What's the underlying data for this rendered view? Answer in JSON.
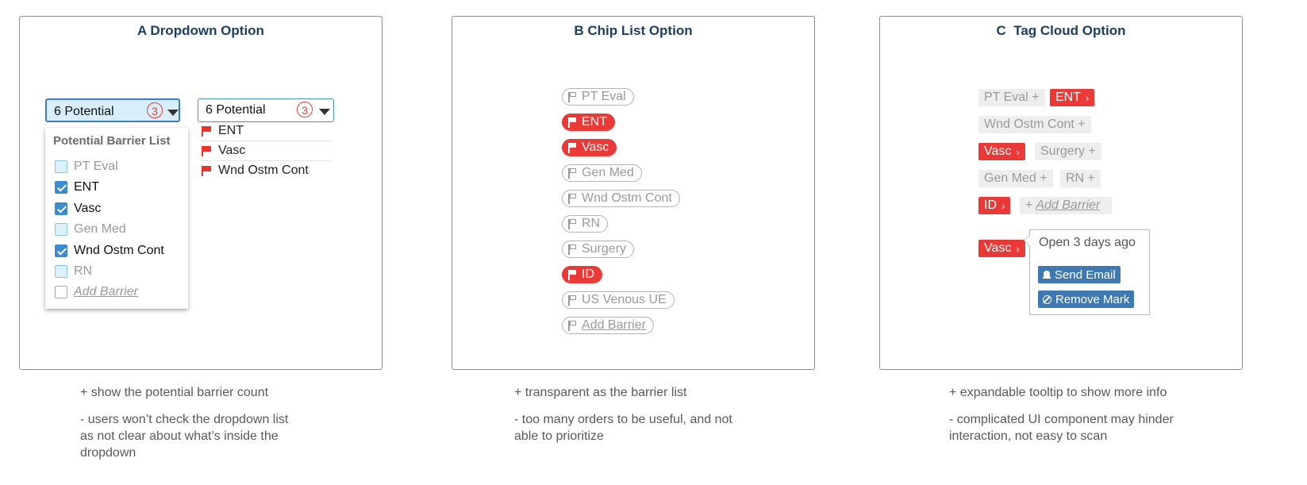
{
  "panels": {
    "a": {
      "title": "A Dropdown Option",
      "dropdown_active": {
        "label": "6 Potential",
        "count": "3"
      },
      "dropdown_flagged": {
        "label": "6 Potential",
        "count": "3"
      },
      "menu": {
        "heading": "Potential Barrier List",
        "items": [
          {
            "label": "PT Eval",
            "state": "unchecked"
          },
          {
            "label": "ENT",
            "state": "checked"
          },
          {
            "label": "Vasc",
            "state": "checked"
          },
          {
            "label": "Gen Med",
            "state": "unchecked"
          },
          {
            "label": "Wnd Ostm Cont",
            "state": "checked"
          },
          {
            "label": "RN",
            "state": "unchecked"
          },
          {
            "label": "Add Barrier",
            "state": "add"
          }
        ]
      },
      "flagged_list": [
        "ENT",
        "Vasc",
        "Wnd Ostm Cont"
      ]
    },
    "b": {
      "title": "B Chip List Option",
      "chips": [
        {
          "label": "PT Eval",
          "flagged": false
        },
        {
          "label": "ENT",
          "flagged": true
        },
        {
          "label": "Vasc",
          "flagged": true
        },
        {
          "label": "Gen Med",
          "flagged": false
        },
        {
          "label": "Wnd Ostm Cont",
          "flagged": false
        },
        {
          "label": "RN",
          "flagged": false
        },
        {
          "label": "Surgery",
          "flagged": false
        },
        {
          "label": "ID",
          "flagged": true
        },
        {
          "label": "US Venous UE",
          "flagged": false
        },
        {
          "label": "Add Barrier",
          "flagged": false
        }
      ]
    },
    "c": {
      "title": "C  Tag Cloud Option",
      "tags": {
        "pt_eval": "PT Eval +",
        "ent": "ENT",
        "wnd": "Wnd Ostm Cont +",
        "vasc": "Vasc",
        "surgery": "Surgery +",
        "gen_med": "Gen Med +",
        "rn": "RN +",
        "id": "ID",
        "add_prefix": "+",
        "add": "Add Barrier",
        "vasc_open": "Vasc"
      },
      "tooltip": {
        "text": "Open 3 days ago",
        "send_email": "Send Email",
        "remove_mark": "Remove Mark"
      }
    }
  },
  "notes": {
    "a": {
      "pro": "+ show the potential barrier count",
      "con": "- users won’t check the dropdown list as not clear about what’s inside the dropdown"
    },
    "b": {
      "pro": "+ transparent as the barrier list",
      "con": "- too many orders to be useful, and not able to prioritize"
    },
    "c": {
      "pro": "+ expandable tooltip to show more info",
      "con": "- complicated UI component may hinder interaction, not easy to scan"
    }
  },
  "colors": {
    "accent_red": "#ea3a37",
    "title_blue": "#1d3f63",
    "button_blue": "#3f79b2",
    "check_blue": "#3d8bcf"
  }
}
